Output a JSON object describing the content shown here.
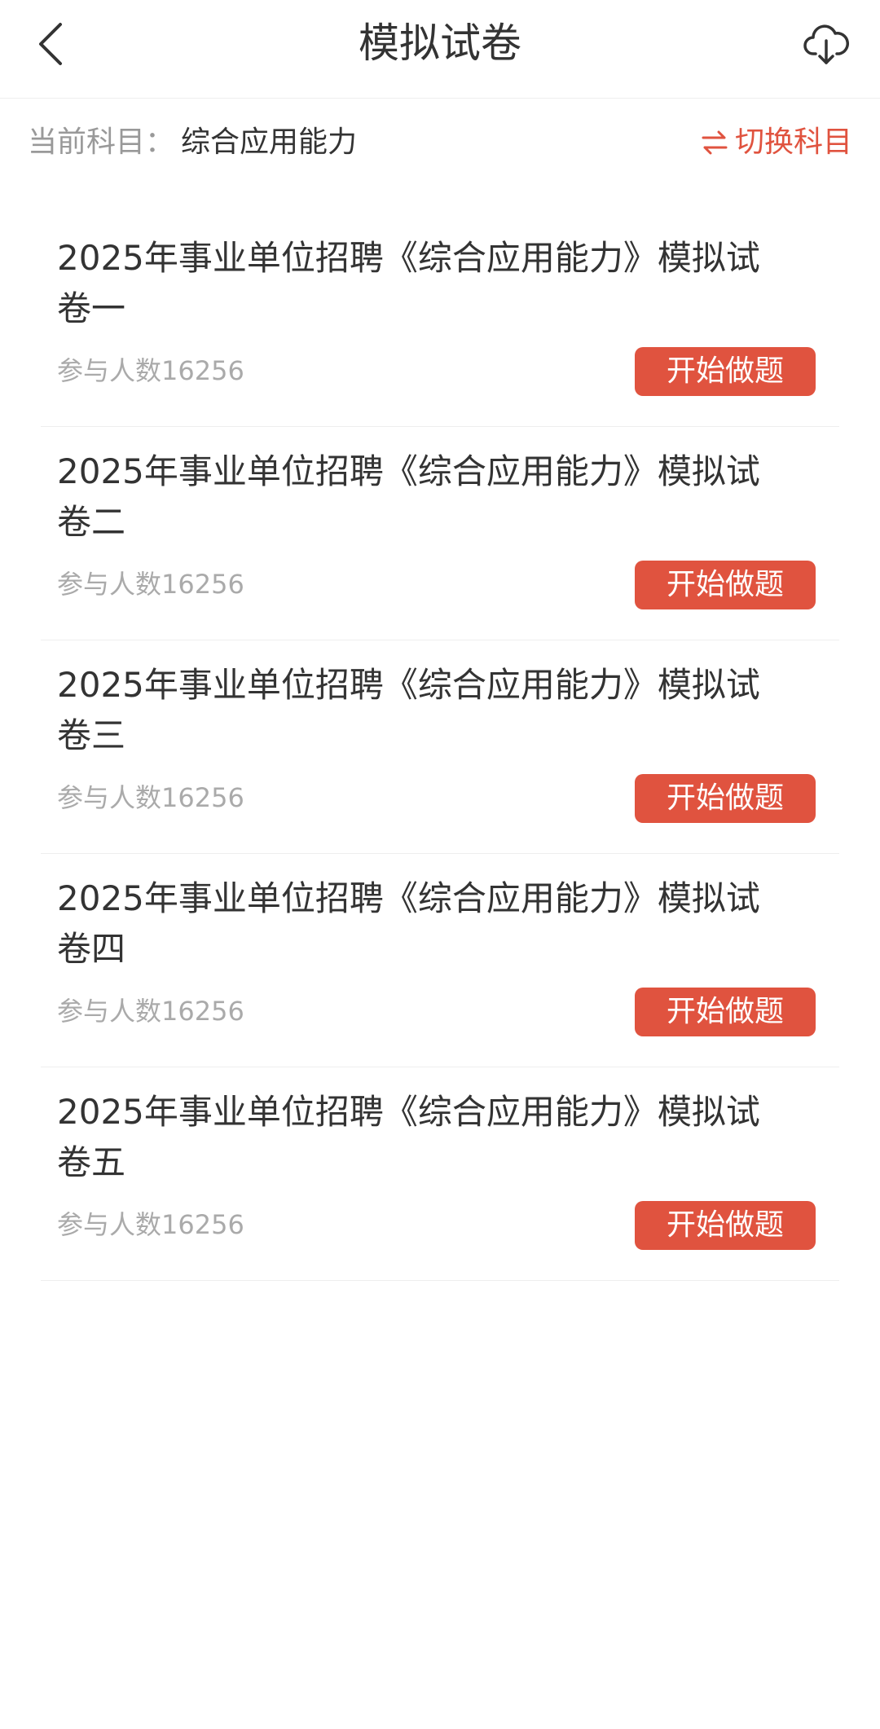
{
  "header": {
    "title": "模拟试卷",
    "back_icon": "chevron-left-icon",
    "download_icon": "cloud-download-icon"
  },
  "subject": {
    "label": "当前科目：",
    "value": "综合应用能力",
    "switch_label": "切换科目",
    "switch_icon": "swap-icon"
  },
  "colors": {
    "accent": "#e0533f",
    "text_primary": "#333333",
    "text_secondary": "#999999"
  },
  "papers": [
    {
      "title": "2025年事业单位招聘《综合应用能力》模拟试卷一",
      "count": "参与人数16256",
      "button": "开始做题"
    },
    {
      "title": "2025年事业单位招聘《综合应用能力》模拟试卷二",
      "count": "参与人数16256",
      "button": "开始做题"
    },
    {
      "title": "2025年事业单位招聘《综合应用能力》模拟试卷三",
      "count": "参与人数16256",
      "button": "开始做题"
    },
    {
      "title": "2025年事业单位招聘《综合应用能力》模拟试卷四",
      "count": "参与人数16256",
      "button": "开始做题"
    },
    {
      "title": "2025年事业单位招聘《综合应用能力》模拟试卷五",
      "count": "参与人数16256",
      "button": "开始做题"
    }
  ]
}
